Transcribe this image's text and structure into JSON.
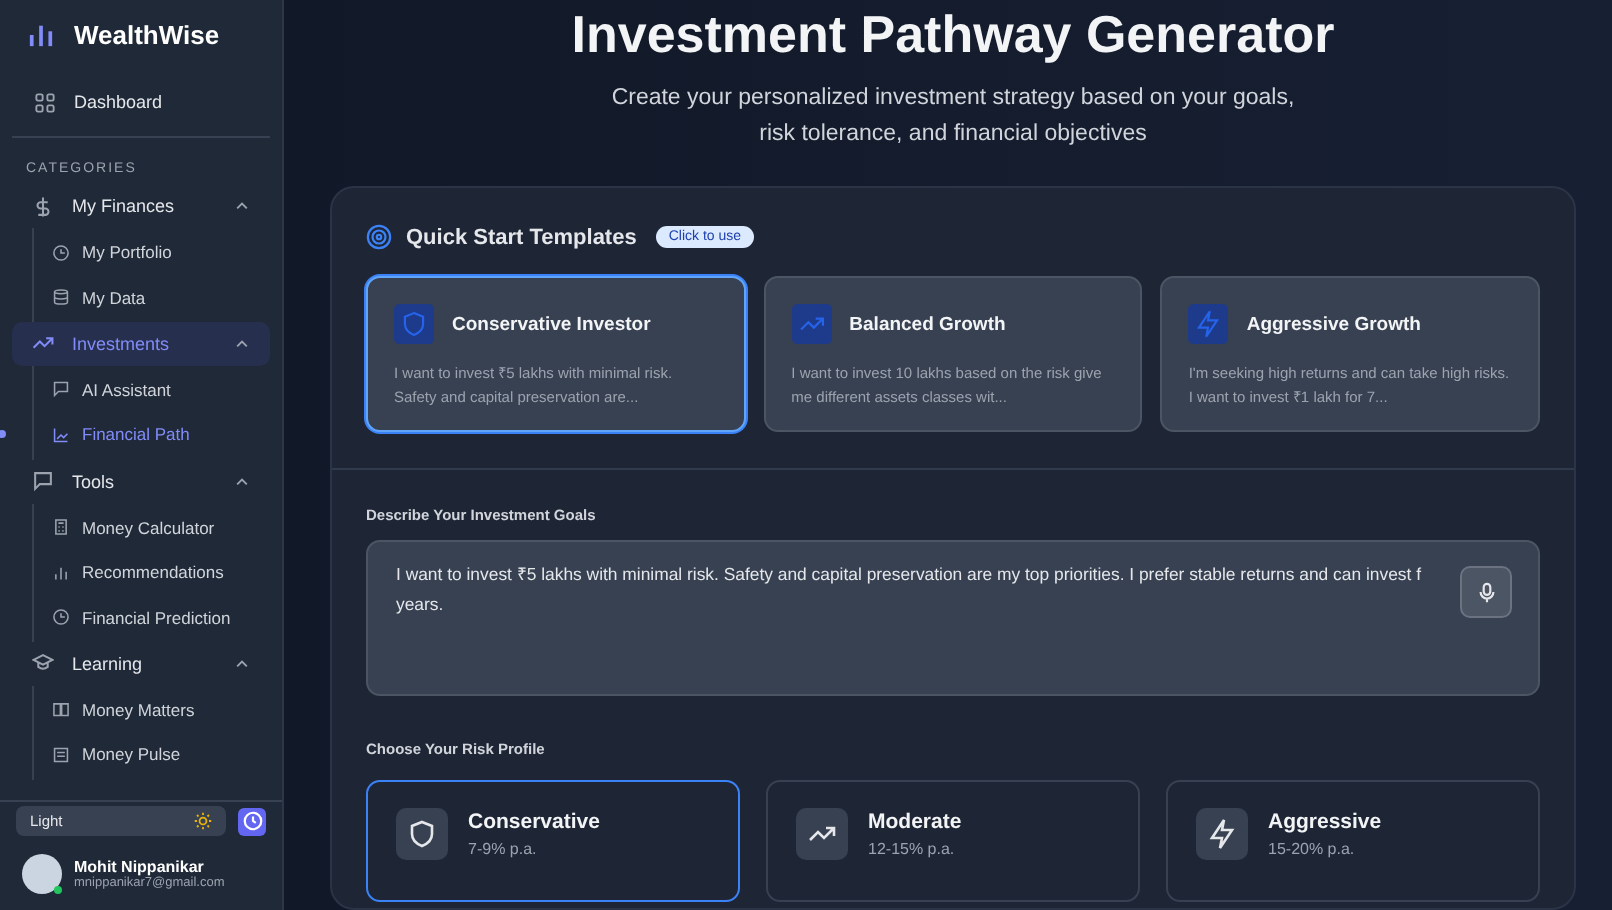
{
  "app": {
    "name": "WealthWise"
  },
  "sidebar": {
    "dashboard": "Dashboard",
    "section_label": "CATEGORIES",
    "groups": [
      {
        "label": "My Finances",
        "expanded": true,
        "selected": false,
        "children": [
          {
            "label": "My Portfolio",
            "selected": false
          },
          {
            "label": "My Data",
            "selected": false
          }
        ]
      },
      {
        "label": "Investments",
        "expanded": true,
        "selected": true,
        "children": [
          {
            "label": "AI Assistant",
            "selected": false
          },
          {
            "label": "Financial Path",
            "selected": true
          }
        ]
      },
      {
        "label": "Tools",
        "expanded": true,
        "selected": false,
        "children": [
          {
            "label": "Money Calculator",
            "selected": false
          },
          {
            "label": "Recommendations",
            "selected": false
          },
          {
            "label": "Financial Prediction",
            "selected": false
          }
        ]
      },
      {
        "label": "Learning",
        "expanded": true,
        "selected": false,
        "children": [
          {
            "label": "Money Matters",
            "selected": false
          },
          {
            "label": "Money Pulse",
            "selected": false
          }
        ]
      }
    ],
    "theme": {
      "label": "Light"
    },
    "user": {
      "name": "Mohit Nippanikar",
      "email": "mnippanikar7@gmail.com",
      "online": true
    }
  },
  "header": {
    "title": "Investment Pathway Generator",
    "subtitle": "Create your personalized investment strategy based on your goals, risk tolerance, and financial objectives"
  },
  "templates": {
    "title": "Quick Start Templates",
    "badge": "Click to use",
    "items": [
      {
        "title": "Conservative Investor",
        "text": "I want to invest ₹5 lakhs with minimal risk. Safety and capital preservation are...",
        "selected": true
      },
      {
        "title": "Balanced Growth",
        "text": "I want to invest 10 lakhs based on the risk give me different assets classes wit...",
        "selected": false
      },
      {
        "title": "Aggressive Growth",
        "text": "I'm seeking high returns and can take high risks. I want to invest ₹1 lakh for 7...",
        "selected": false
      }
    ]
  },
  "goals": {
    "label": "Describe Your Investment Goals",
    "value_lines": [
      "I want to invest ₹5 lakhs with minimal risk. Safety and capital preservation are my top priorities. I prefer stable returns and can invest f",
      "years."
    ]
  },
  "risk": {
    "label": "Choose Your Risk Profile",
    "items": [
      {
        "name": "Conservative",
        "rate": "7-9% p.a.",
        "selected": true
      },
      {
        "name": "Moderate",
        "rate": "12-15% p.a.",
        "selected": false
      },
      {
        "name": "Aggressive",
        "rate": "15-20% p.a.",
        "selected": false
      }
    ]
  }
}
